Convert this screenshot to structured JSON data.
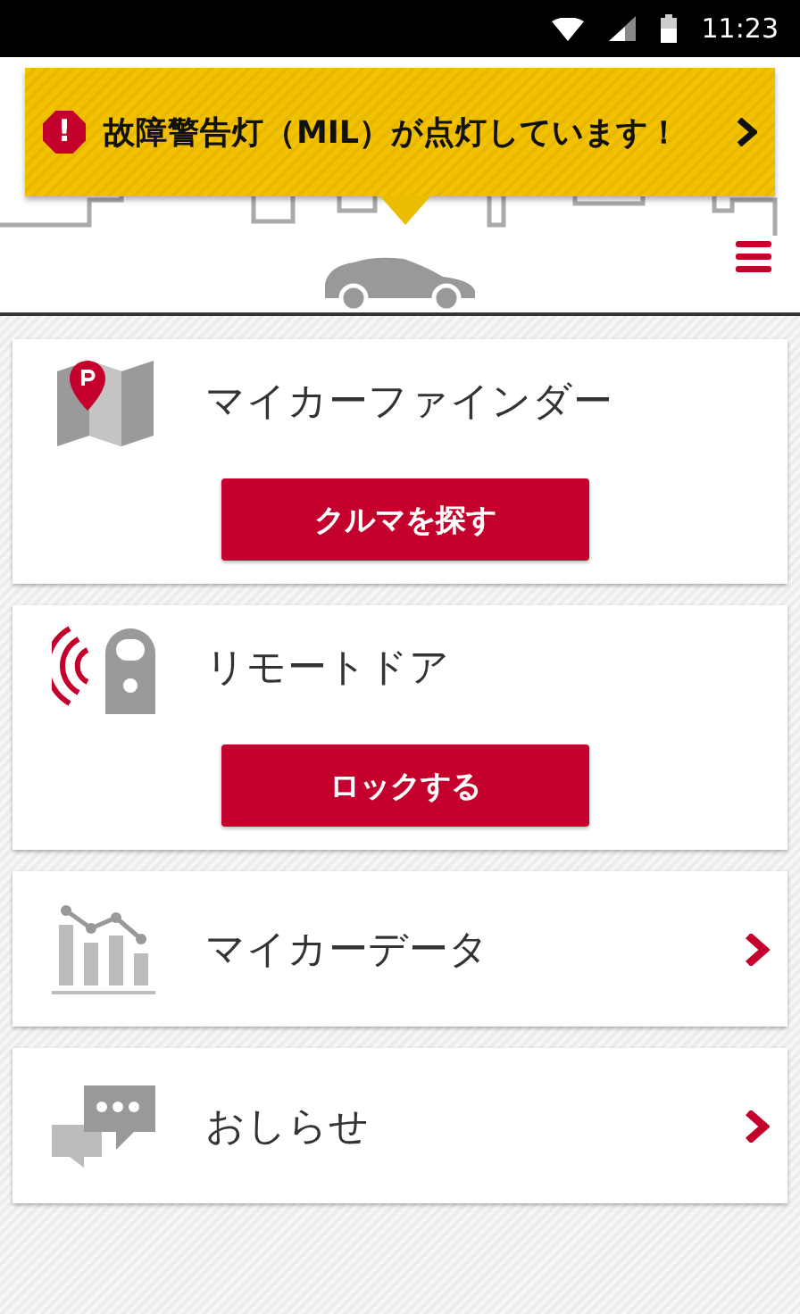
{
  "status_bar": {
    "time": "11:23"
  },
  "alert": {
    "icon": "!",
    "text": "故障警告灯（MIL）が点灯しています！"
  },
  "cards": [
    {
      "kind": "button",
      "title": "マイカーファインダー",
      "button": "クルマを探す"
    },
    {
      "kind": "button",
      "title": "リモートドア",
      "button": "ロックする"
    },
    {
      "kind": "link",
      "title": "マイカーデータ"
    },
    {
      "kind": "link",
      "title": "おしらせ"
    }
  ]
}
